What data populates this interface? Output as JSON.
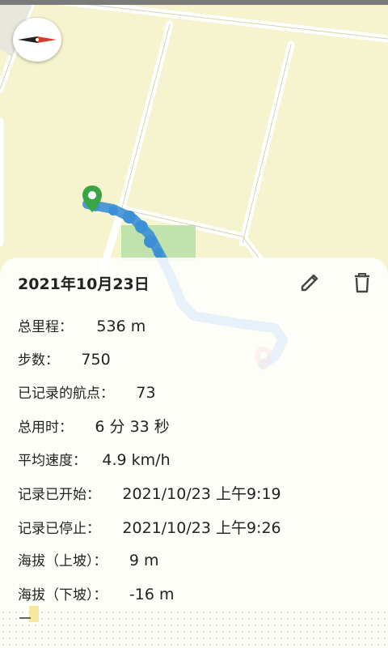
{
  "record": {
    "title": "2021年10月23日",
    "stats": [
      {
        "label": "总里程：",
        "value": "536 m"
      },
      {
        "label": "步数：",
        "value": "750"
      },
      {
        "label": "已记录的航点：",
        "value": "73"
      },
      {
        "label": "总用时：",
        "value": "6 分 33 秒"
      },
      {
        "label": "平均速度：",
        "value": "4.9 km/h"
      },
      {
        "label": "记录已开始：",
        "value": "2021/10/23 上午9:19"
      },
      {
        "label": "记录已停止：",
        "value": "2021/10/23 上午9:26"
      },
      {
        "label": "海拔（上坡）：",
        "value": "9 m"
      },
      {
        "label": "海拔（下坡）：",
        "value": "-16 m"
      }
    ]
  },
  "icons": {
    "compass": "compass-icon",
    "edit": "pencil-icon",
    "delete": "trash-icon",
    "start_pin": "start-pin-icon",
    "end_pin": "end-pin-icon"
  },
  "colors": {
    "map_background": "#f6f3cf",
    "road": "#ffffff",
    "route": "#3d8fd6",
    "start_pin": "#3aa545",
    "end_pin": "#e25a5a",
    "park": "#b6dea6"
  }
}
